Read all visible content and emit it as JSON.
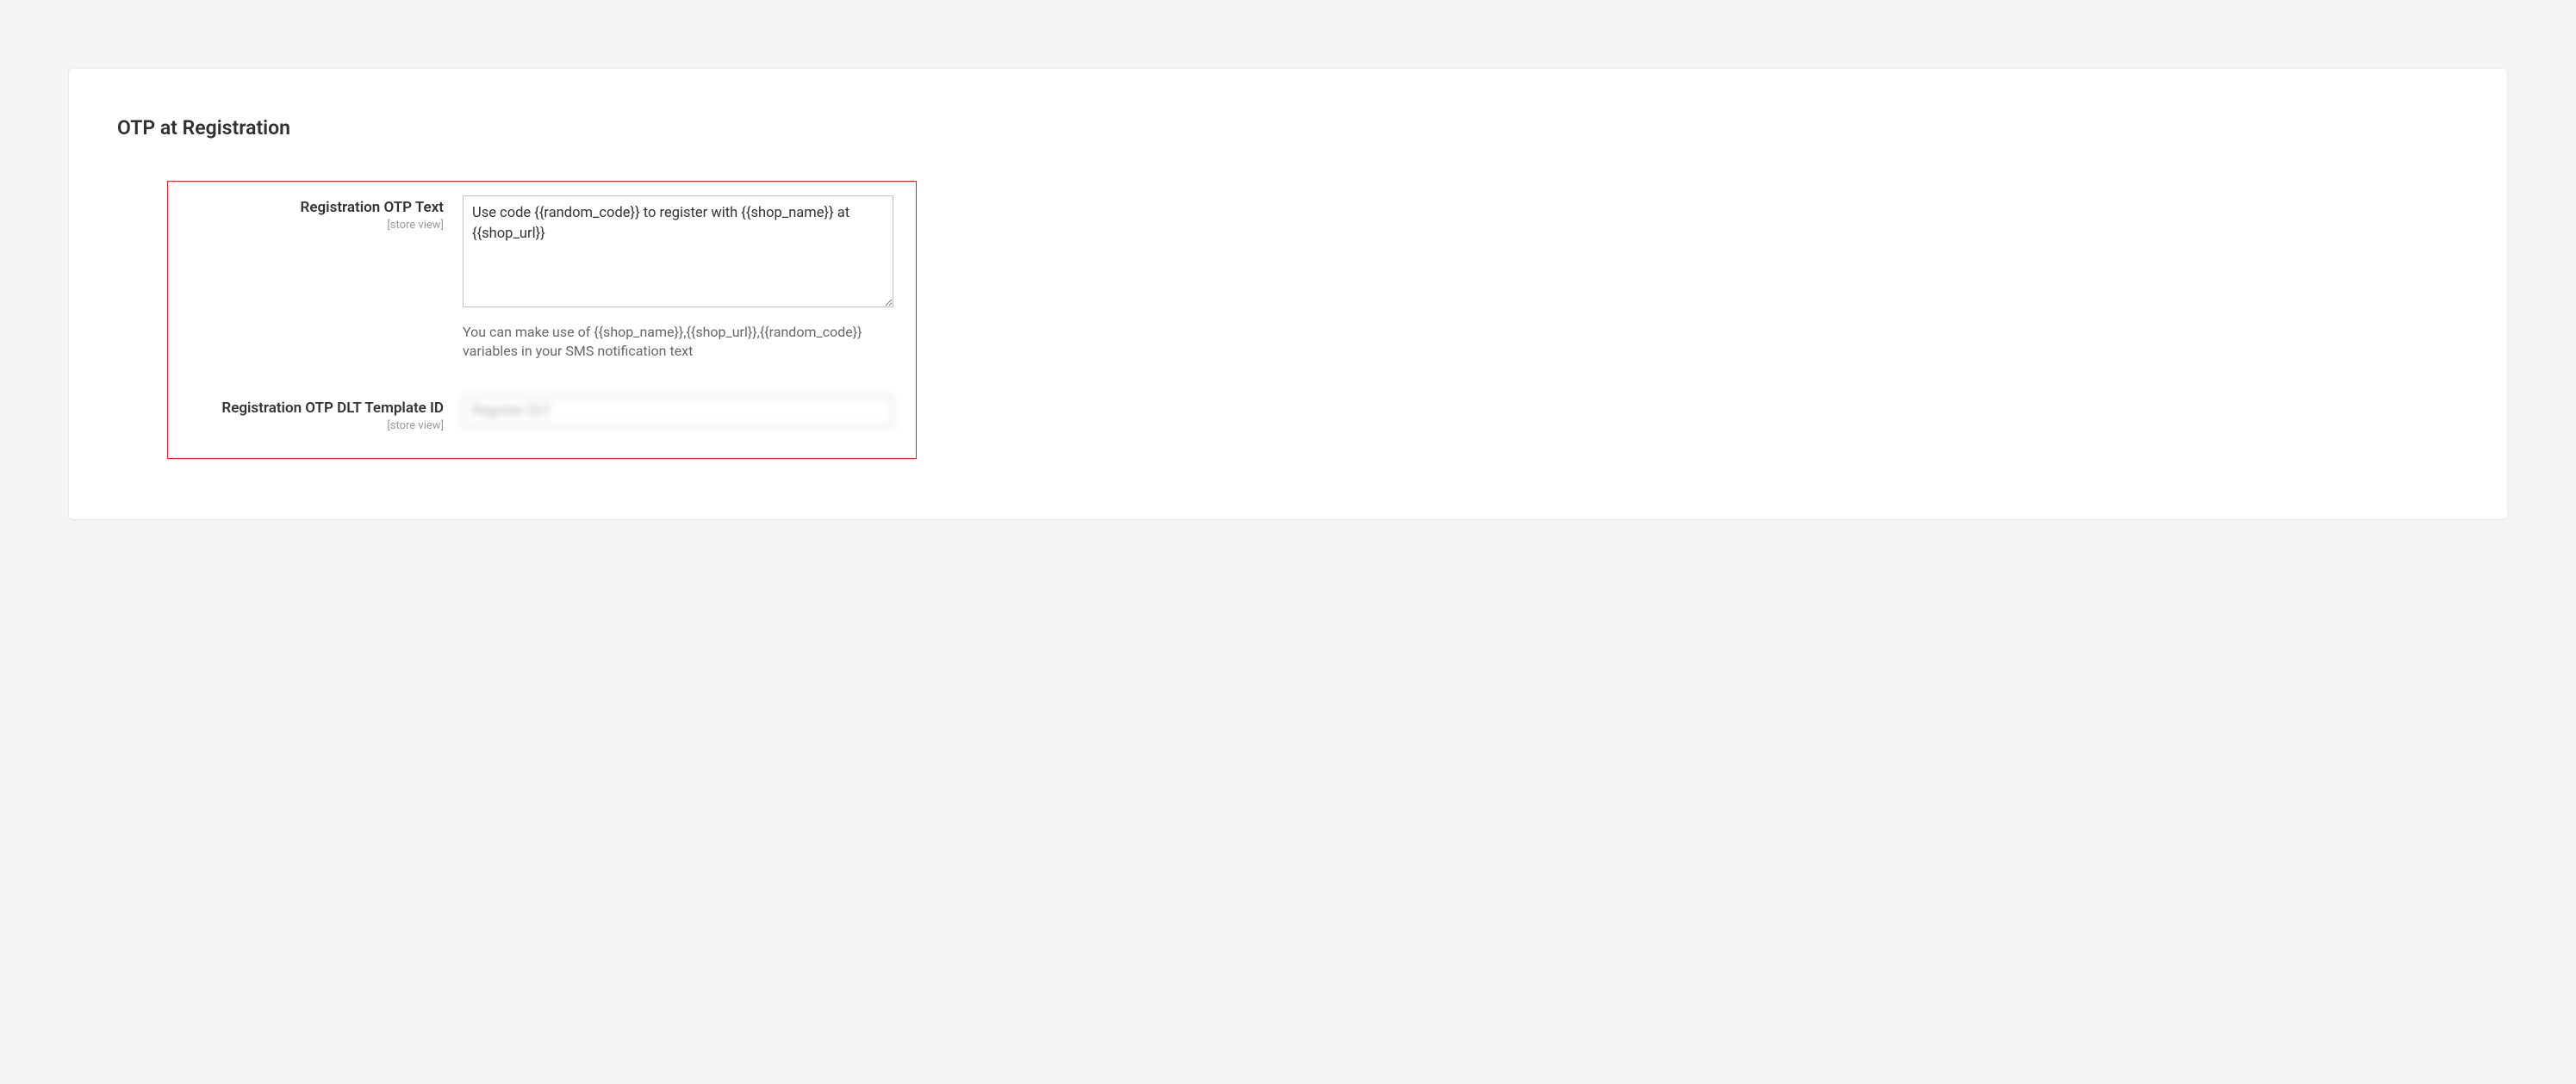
{
  "section": {
    "title": "OTP at Registration"
  },
  "fields": {
    "otp_text": {
      "label": "Registration OTP Text",
      "scope": "[store view]",
      "value": "Use code {{random_code}} to register with {{shop_name}} at {{shop_url}}",
      "help": "You can make use of {{shop_name}},{{shop_url}},{{random_code}} variables in your SMS notification text"
    },
    "dlt_template": {
      "label": "Registration OTP DLT Template ID",
      "scope": "[store view]",
      "value": "Register DLT"
    }
  }
}
